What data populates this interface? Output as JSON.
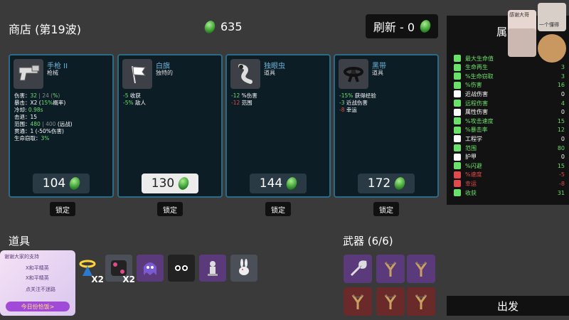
{
  "shop": {
    "title": "商店 (第19波)",
    "materials": "635",
    "refresh_label": "刷新 - 0"
  },
  "cards": [
    {
      "name": "手枪 II",
      "type": "枪械",
      "icon": "pistol-icon",
      "stats": [
        [
          [
            "伤害：",
            ""
          ],
          [
            "32",
            "g"
          ],
          [
            " | 24 (",
            "d"
          ],
          [
            "%",
            "g"
          ],
          [
            ")",
            "d"
          ]
        ],
        [
          [
            "暴击：X2 (",
            ""
          ],
          [
            "15%",
            "g"
          ],
          [
            "概率)",
            ""
          ]
        ],
        [
          [
            "冷却: ",
            ""
          ],
          [
            "0.98s",
            "g"
          ]
        ],
        [
          [
            "击退：15",
            ""
          ]
        ],
        [
          [
            "范围：",
            ""
          ],
          [
            "480",
            "g"
          ],
          [
            " | 400 ",
            "d"
          ],
          [
            "(远战)",
            ""
          ]
        ],
        [
          [
            "贯通：1 (-50%伤害)",
            ""
          ]
        ],
        [
          [
            "生命窃取：",
            ""
          ],
          [
            "3%",
            "g"
          ]
        ]
      ],
      "price": "104",
      "lock_label": "锁定"
    },
    {
      "name": "白旗",
      "type": "独特的",
      "icon": "white-flag-icon",
      "stats": [
        [
          [
            "-5",
            "g"
          ],
          [
            " 收获",
            ""
          ]
        ],
        [
          [
            "-5%",
            "g"
          ],
          [
            " 敌人",
            ""
          ]
        ]
      ],
      "price": "130",
      "lock_label": "锁定"
    },
    {
      "name": "独眼虫",
      "type": "道具",
      "icon": "cyclops-worm-icon",
      "stats": [
        [
          [
            "-12",
            "g"
          ],
          [
            " %伤害",
            ""
          ]
        ],
        [
          [
            "-12",
            "r"
          ],
          [
            " 范围",
            ""
          ]
        ]
      ],
      "price": "144",
      "lock_label": "锁定"
    },
    {
      "name": "黑带",
      "type": "道具",
      "icon": "black-belt-icon",
      "stats": [
        [
          [
            "-15%",
            "g"
          ],
          [
            " 获得经验",
            ""
          ]
        ],
        [
          [
            "-3",
            "g"
          ],
          [
            " 近战伤害",
            ""
          ]
        ],
        [
          [
            "-8",
            "r"
          ],
          [
            " 幸运",
            ""
          ]
        ]
      ],
      "price": "172",
      "lock_label": "锁定"
    }
  ],
  "attributes_header": "属",
  "attributes": [
    {
      "label": "最大生命值",
      "value": "",
      "color": "#6be06b",
      "icon": "heart-icon"
    },
    {
      "label": "生命再生",
      "value": "3",
      "color": "#6be06b",
      "icon": "regen-icon"
    },
    {
      "label": "%生命窃取",
      "value": "3",
      "color": "#6be06b",
      "icon": "lifesteal-icon"
    },
    {
      "label": "%伤害",
      "value": "16",
      "color": "#6be06b",
      "icon": "damage-icon"
    },
    {
      "label": "近战伤害",
      "value": "0",
      "color": "#ffffff",
      "icon": "melee-icon"
    },
    {
      "label": "远程伤害",
      "value": "4",
      "color": "#6be06b",
      "icon": "ranged-icon"
    },
    {
      "label": "属性伤害",
      "value": "0",
      "color": "#ffffff",
      "icon": "elemental-icon"
    },
    {
      "label": "%攻击速度",
      "value": "15",
      "color": "#6be06b",
      "icon": "attack-speed-icon"
    },
    {
      "label": "%暴击率",
      "value": "12",
      "color": "#6be06b",
      "icon": "crit-icon"
    },
    {
      "label": "工程学",
      "value": "0",
      "color": "#ffffff",
      "icon": "engineering-icon"
    },
    {
      "label": "范围",
      "value": "80",
      "color": "#6be06b",
      "icon": "range-icon"
    },
    {
      "label": "护甲",
      "value": "0",
      "color": "#ffffff",
      "icon": "armor-icon"
    },
    {
      "label": "%闪避",
      "value": "15",
      "color": "#6be06b",
      "icon": "dodge-icon"
    },
    {
      "label": "%速度",
      "value": "-5",
      "color": "#e04a4a",
      "icon": "speed-icon"
    },
    {
      "label": "幸运",
      "value": "-8",
      "color": "#e04a4a",
      "icon": "luck-icon"
    },
    {
      "label": "收获",
      "value": "31",
      "color": "#6be06b",
      "icon": "harvest-icon"
    }
  ],
  "items_label": "道具",
  "items": [
    {
      "icon": "halo-icon",
      "count": "X2"
    },
    {
      "icon": "dice-icon",
      "count": "X2"
    },
    {
      "icon": "ghost-icon",
      "count": ""
    },
    {
      "icon": "eyes-icon",
      "count": ""
    },
    {
      "icon": "statue-icon",
      "count": ""
    },
    {
      "icon": "rabbit-icon",
      "count": ""
    }
  ],
  "weapons_label": "武器 (6/6)",
  "weapons": [
    {
      "icon": "wrench-icon",
      "tier": "purple"
    },
    {
      "icon": "slingshot-icon",
      "tier": "purple"
    },
    {
      "icon": "slingshot-icon",
      "tier": "purple"
    },
    {
      "icon": "slingshot-icon",
      "tier": "red"
    },
    {
      "icon": "slingshot-icon",
      "tier": "red"
    },
    {
      "icon": "slingshot-icon",
      "tier": "red"
    }
  ],
  "go_label": "出发",
  "stream": {
    "cam1_label": "感谢大哥",
    "cam2_label": "一个懂得",
    "overlay_lines": [
      "谢谢大家的支持",
      "X和平精英",
      "X和平精英",
      "点关注不迷路",
      "今日份恰饭>"
    ]
  },
  "colors": {
    "gem": "#4fbf3a",
    "purple_slot": "#5a3a7a",
    "red_slot": "#6a2a2a",
    "card_border": "#2d6a86"
  }
}
